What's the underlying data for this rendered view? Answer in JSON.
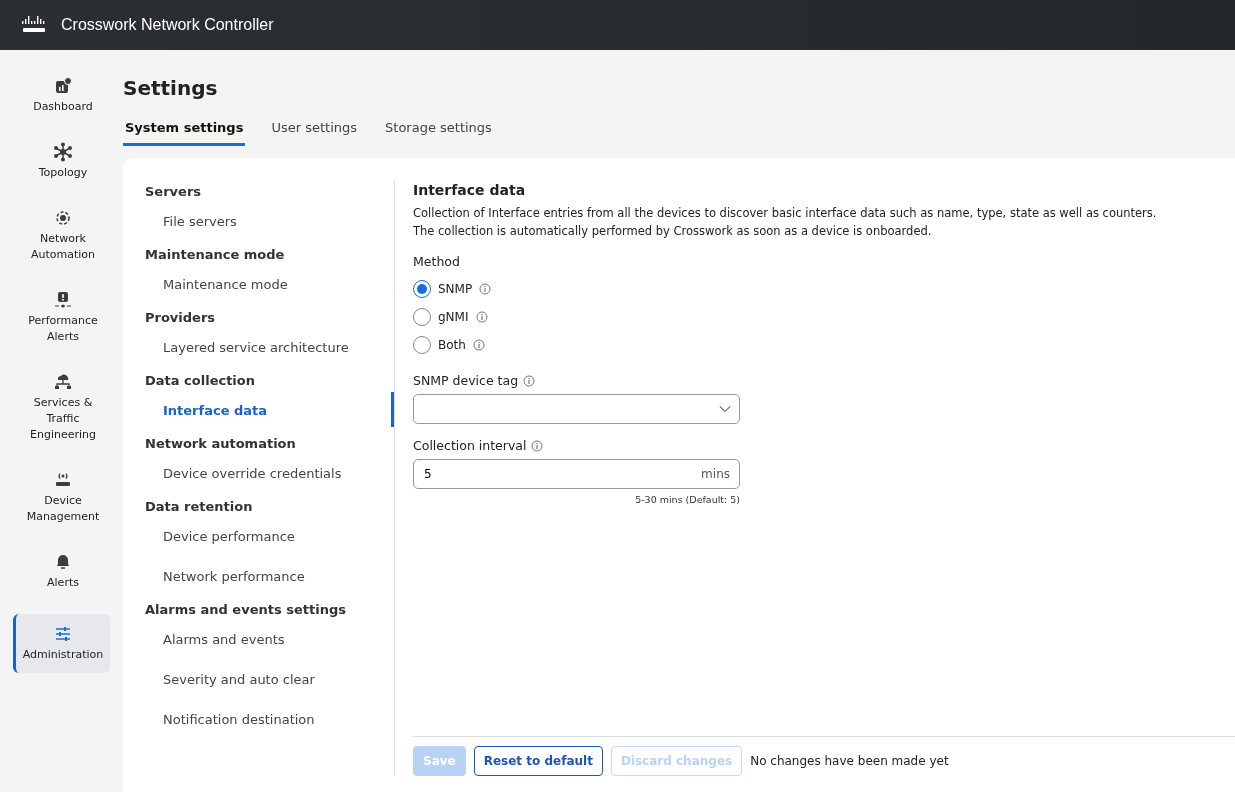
{
  "header": {
    "brand": "Crosswork Network Controller"
  },
  "nav": [
    {
      "kind": "dashboard",
      "label": "Dashboard",
      "selected": false
    },
    {
      "kind": "topology",
      "label": "Topology",
      "selected": false
    },
    {
      "kind": "automation",
      "label": "Network Automation",
      "selected": false
    },
    {
      "kind": "perf",
      "label": "Performance Alerts",
      "selected": false
    },
    {
      "kind": "services",
      "label": "Services & Traffic Engineering",
      "selected": false
    },
    {
      "kind": "device",
      "label": "Device Management",
      "selected": false
    },
    {
      "kind": "alerts",
      "label": "Alerts",
      "selected": false
    },
    {
      "kind": "admin",
      "label": "Administration",
      "selected": true
    }
  ],
  "page": {
    "title": "Settings"
  },
  "tabs": [
    {
      "label": "System settings",
      "selected": true
    },
    {
      "label": "User settings",
      "selected": false
    },
    {
      "label": "Storage settings",
      "selected": false
    }
  ],
  "menu": [
    {
      "heading": "Servers",
      "items": [
        {
          "label": "File servers",
          "selected": false
        }
      ]
    },
    {
      "heading": "Maintenance mode",
      "items": [
        {
          "label": "Maintenance mode",
          "selected": false
        }
      ]
    },
    {
      "heading": "Providers",
      "items": [
        {
          "label": "Layered service architecture",
          "selected": false
        }
      ]
    },
    {
      "heading": "Data collection",
      "items": [
        {
          "label": "Interface data",
          "selected": true
        }
      ]
    },
    {
      "heading": "Network automation",
      "items": [
        {
          "label": "Device override credentials",
          "selected": false
        }
      ]
    },
    {
      "heading": "Data retention",
      "items": [
        {
          "label": "Device performance",
          "selected": false
        },
        {
          "label": "Network performance",
          "selected": false
        }
      ]
    },
    {
      "heading": "Alarms and events settings",
      "items": [
        {
          "label": "Alarms and events",
          "selected": false
        },
        {
          "label": "Severity and auto clear",
          "selected": false
        },
        {
          "label": "Notification destination",
          "selected": false
        }
      ]
    }
  ],
  "content": {
    "title": "Interface data",
    "description": [
      "Collection of Interface entries from all the devices to discover basic interface data such as name, type, state as well as counters.",
      "The collection is automatically performed by Crosswork as soon as a device is onboarded."
    ],
    "method_label": "Method",
    "methods": [
      {
        "label": "SNMP",
        "selected": true
      },
      {
        "label": "gNMI",
        "selected": false
      },
      {
        "label": "Both",
        "selected": false
      }
    ],
    "tag_label": "SNMP device tag",
    "interval_label": "Collection interval",
    "interval_value": "5",
    "interval_unit": "mins",
    "interval_hint": "5-30 mins (Default: 5)"
  },
  "footer": {
    "buttons": [
      {
        "label": "Save",
        "kind": "primary",
        "disabled": true
      },
      {
        "label": "Reset to default",
        "kind": "secondary",
        "disabled": false
      },
      {
        "label": "Discard changes",
        "kind": "secondary",
        "disabled": true
      }
    ],
    "status": "No changes have been made yet"
  }
}
